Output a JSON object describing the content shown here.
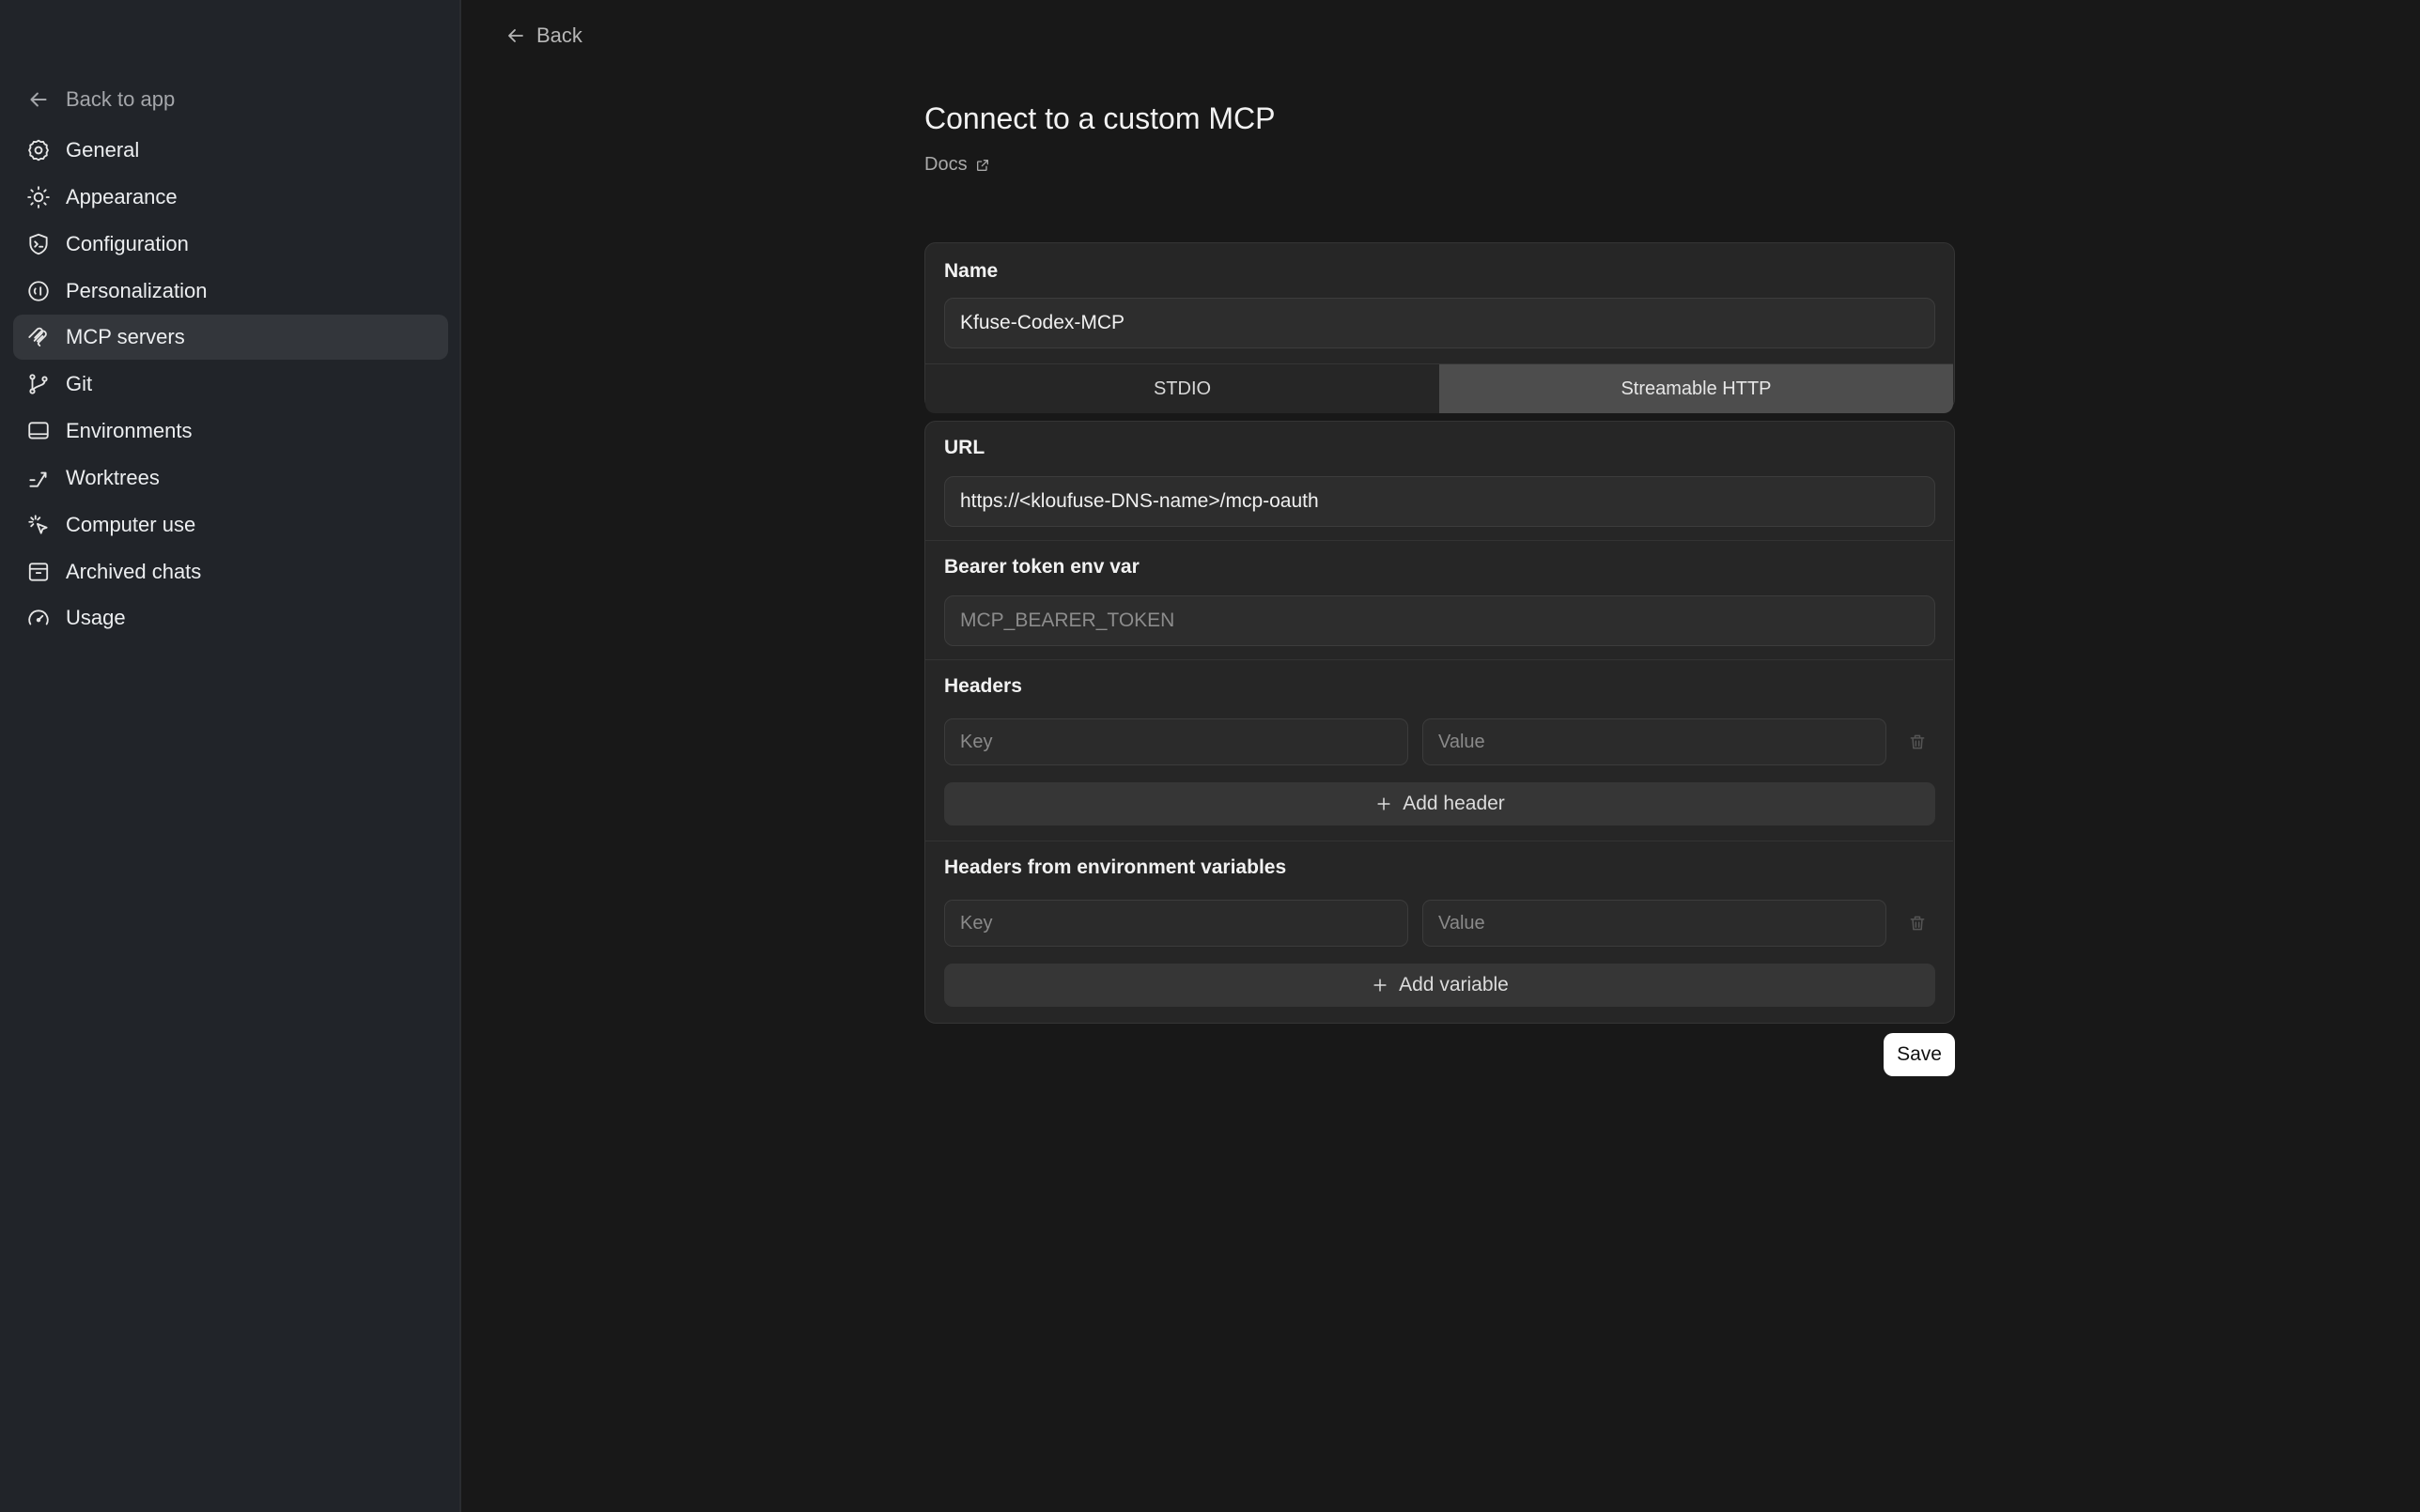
{
  "sidebar": {
    "back_label": "Back to app",
    "items": [
      {
        "label": "General",
        "icon": "gear-icon"
      },
      {
        "label": "Appearance",
        "icon": "sun-icon"
      },
      {
        "label": "Configuration",
        "icon": "terminal-shield-icon"
      },
      {
        "label": "Personalization",
        "icon": "smile-icon"
      },
      {
        "label": "MCP servers",
        "icon": "mcp-icon",
        "active": true
      },
      {
        "label": "Git",
        "icon": "git-branch-icon"
      },
      {
        "label": "Environments",
        "icon": "monitor-icon"
      },
      {
        "label": "Worktrees",
        "icon": "worktree-icon"
      },
      {
        "label": "Computer use",
        "icon": "cursor-click-icon"
      },
      {
        "label": "Archived chats",
        "icon": "archive-icon"
      },
      {
        "label": "Usage",
        "icon": "gauge-icon"
      }
    ]
  },
  "main": {
    "back_label": "Back",
    "title": "Connect to a custom MCP",
    "docs_label": "Docs",
    "name": {
      "label": "Name",
      "value": "Kfuse-Codex-MCP"
    },
    "transport": {
      "options": [
        "STDIO",
        "Streamable HTTP"
      ],
      "selected": "Streamable HTTP"
    },
    "url": {
      "label": "URL",
      "value": "https://<kloufuse-DNS-name>/mcp-oauth"
    },
    "bearer": {
      "label": "Bearer token env var",
      "placeholder": "MCP_BEARER_TOKEN",
      "value": ""
    },
    "headers": {
      "label": "Headers",
      "key_placeholder": "Key",
      "value_placeholder": "Value",
      "add_label": "Add header"
    },
    "env_headers": {
      "label": "Headers from environment variables",
      "key_placeholder": "Key",
      "value_placeholder": "Value",
      "add_label": "Add variable"
    },
    "save_label": "Save"
  },
  "colors": {
    "background": "#181818",
    "sidebar": "#212429",
    "active_item": "#33363b",
    "card": "#262626",
    "selected_segment": "#4d4d4d",
    "save_button": "#ffffff"
  }
}
